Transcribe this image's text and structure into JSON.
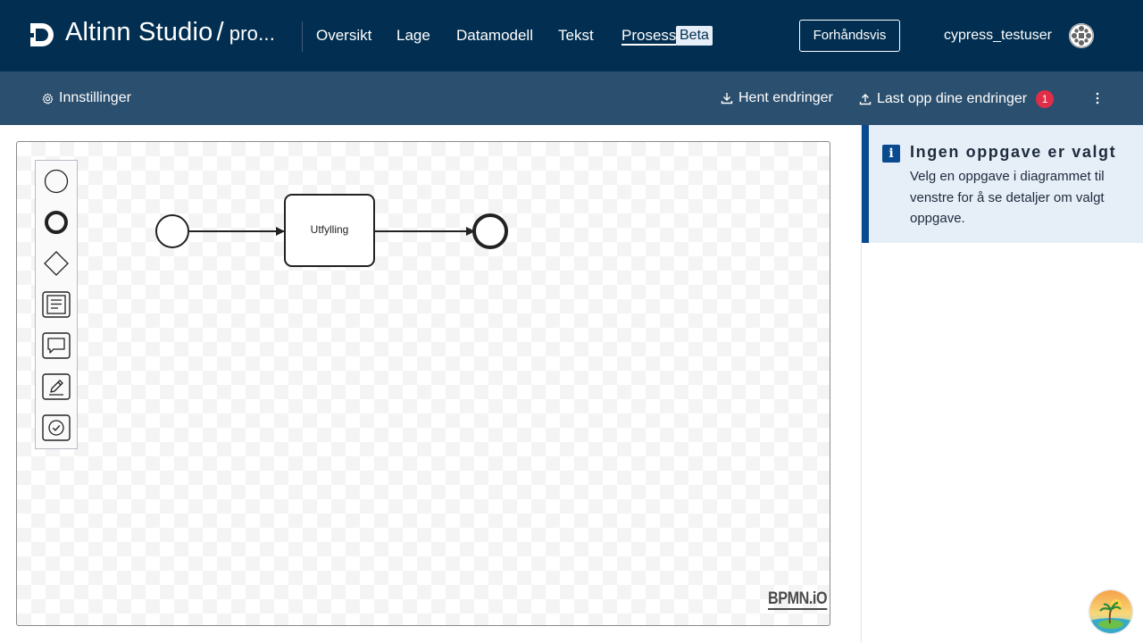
{
  "header": {
    "app_name": "Altinn Studio",
    "separator": "/",
    "repo_name": "pro...",
    "nav": [
      {
        "label": "Oversikt"
      },
      {
        "label": "Lage"
      },
      {
        "label": "Datamodell"
      },
      {
        "label": "Tekst"
      },
      {
        "label": "Prosess",
        "active": true
      }
    ],
    "beta_badge": "Beta",
    "preview_button": "Forhåndsvis",
    "username": "cypress_testuser",
    "colors": {
      "background": "#022f51",
      "accent": "#e6eef7"
    }
  },
  "subheader": {
    "settings_label": "Innstillinger",
    "fetch_label": "Hent endringer",
    "upload_label": "Last opp dine endringer",
    "upload_badge": "1",
    "colors": {
      "background": "#2b4f6e",
      "badge": "#e02e49"
    }
  },
  "diagram": {
    "palette_tools": [
      "start-event-tool",
      "end-event-tool",
      "gateway-tool",
      "data-task-tool",
      "feedback-task-tool",
      "signing-task-tool",
      "confirmation-task-tool"
    ],
    "task_label": "Utfylling",
    "watermark": "BPMN.iO"
  },
  "info_panel": {
    "title": "Ingen oppgave er valgt",
    "text": "Velg en oppgave i diagrammet til venstre for å se detaljer om valgt oppgave.",
    "colors": {
      "background": "#e6eef8",
      "border": "#0a4b8f"
    }
  }
}
